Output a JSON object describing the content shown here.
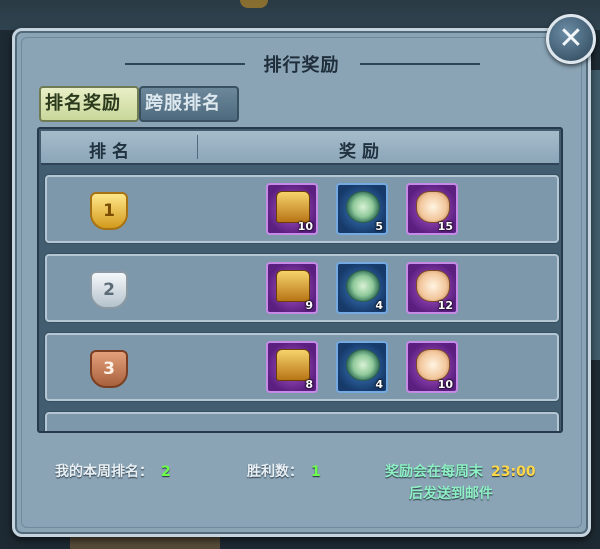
{
  "dialog": {
    "title": "排行奖励",
    "tabs": [
      {
        "label": "排名奖励",
        "active": true
      },
      {
        "label": "跨服排名",
        "active": false
      }
    ],
    "columns": {
      "rank": "排名",
      "reward": "奖励"
    },
    "rows": [
      {
        "rank": "1",
        "medal": "gold",
        "rewards": [
          {
            "icon": "treasure-chest-icon",
            "qty": "10"
          },
          {
            "icon": "jade-disc-icon",
            "qty": "5"
          },
          {
            "icon": "seal-badge-icon",
            "qty": "15"
          }
        ]
      },
      {
        "rank": "2",
        "medal": "silver",
        "rewards": [
          {
            "icon": "treasure-chest-icon",
            "qty": "9"
          },
          {
            "icon": "jade-disc-icon",
            "qty": "4"
          },
          {
            "icon": "seal-badge-icon",
            "qty": "12"
          }
        ]
      },
      {
        "rank": "3",
        "medal": "bronze",
        "rewards": [
          {
            "icon": "treasure-chest-icon",
            "qty": "8"
          },
          {
            "icon": "jade-disc-icon",
            "qty": "4"
          },
          {
            "icon": "seal-badge-icon",
            "qty": "10"
          }
        ]
      }
    ],
    "footer": {
      "my_rank_label": "我的本周排名：",
      "my_rank_value": "2",
      "wins_label": "胜利数：",
      "wins_value": "1",
      "notice_line1": "奖励会在每周末",
      "notice_time": "23:00",
      "notice_line2": "后发送到邮件"
    }
  },
  "colors": {
    "panel": "#8aa4b6",
    "active_tab": "#dfe7b5",
    "highlight_green": "#6cff4a",
    "highlight_yellow": "#ffd84a"
  }
}
